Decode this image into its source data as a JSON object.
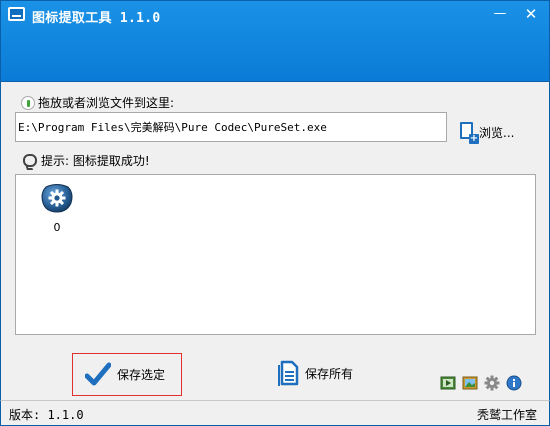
{
  "window": {
    "title": "图标提取工具 1.1.0",
    "minimize_label": "—",
    "close_label": "✕"
  },
  "drop_area": {
    "label": "拖放或者浏览文件到这里:",
    "path_value": "E:\\Program Files\\完美解码\\Pure Codec\\PureSet.exe"
  },
  "browse": {
    "label": "浏览..."
  },
  "tip": {
    "text": "提示: 图标提取成功!"
  },
  "icons": [
    {
      "label": "0",
      "icon": "gear-blob-icon"
    }
  ],
  "actions": {
    "save_selected": "保存选定",
    "save_all": "保存所有"
  },
  "tools": [
    "play-media-icon",
    "image-icon",
    "settings-gear-icon",
    "info-icon"
  ],
  "statusbar": {
    "version": "版本: 1.1.0",
    "studio": "秃鹫工作室"
  },
  "colors": {
    "titlebar": "#0a7bd6",
    "accent": "#1f6fbf",
    "selection_border": "#e03030"
  }
}
